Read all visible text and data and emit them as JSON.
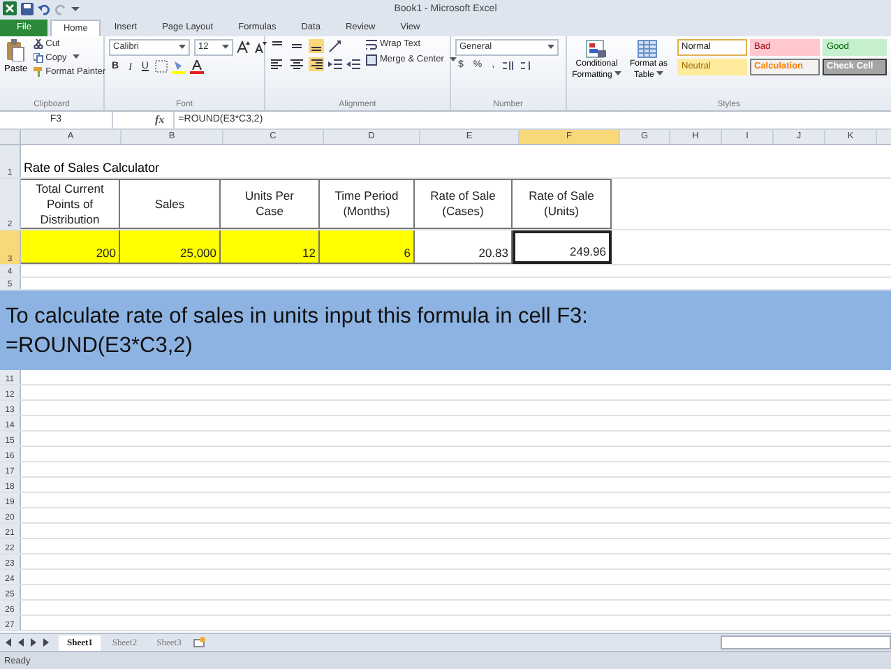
{
  "window": {
    "title": "Book1  -  Microsoft Excel"
  },
  "tabs": [
    {
      "label": "File",
      "selected": false,
      "kind": "file"
    },
    {
      "label": "Home",
      "selected": true,
      "kind": "tab"
    },
    {
      "label": "Insert",
      "selected": false,
      "kind": "tab"
    },
    {
      "label": "Page Layout",
      "selected": false,
      "kind": "tab"
    },
    {
      "label": "Formulas",
      "selected": false,
      "kind": "tab"
    },
    {
      "label": "Data",
      "selected": false,
      "kind": "tab"
    },
    {
      "label": "Review",
      "selected": false,
      "kind": "tab"
    },
    {
      "label": "View",
      "selected": false,
      "kind": "tab"
    }
  ],
  "ribbon": {
    "clipboard": {
      "paste": "Paste",
      "cut": "Cut",
      "copy": "Copy",
      "format_painter": "Format Painter",
      "label": "Clipboard"
    },
    "font": {
      "font_name": "Calibri",
      "font_size": "12",
      "styles": [
        "B",
        "I",
        "U"
      ],
      "label": "Font"
    },
    "alignment": {
      "wrap_text": "Wrap Text",
      "merge_center": "Merge & Center",
      "label": "Alignment"
    },
    "number": {
      "format": "General",
      "symbols": [
        "$",
        "%",
        ","
      ],
      "label": "Number"
    },
    "styles": {
      "conditional_formatting": [
        "Conditional",
        "Formatting"
      ],
      "format_as_table": [
        "Format as",
        "Table"
      ],
      "cells": [
        {
          "label": "Normal",
          "kind": "normal"
        },
        {
          "label": "Bad",
          "kind": "bad"
        },
        {
          "label": "Good",
          "kind": "good"
        },
        {
          "label": "Neutral",
          "kind": "neutral"
        },
        {
          "label": "Calculation",
          "kind": "calculation"
        },
        {
          "label": "Check Cell",
          "kind": "check"
        }
      ],
      "label": "Styles"
    }
  },
  "formula_bar": {
    "name_box": "F3",
    "fx": "fx",
    "formula": "=ROUND(E3*C3,2)"
  },
  "columns": [
    {
      "label": "A",
      "selected": false
    },
    {
      "label": "B",
      "selected": false
    },
    {
      "label": "C",
      "selected": false
    },
    {
      "label": "D",
      "selected": false
    },
    {
      "label": "E",
      "selected": false
    },
    {
      "label": "F",
      "selected": true
    },
    {
      "label": "G",
      "selected": false
    },
    {
      "label": "H",
      "selected": false
    },
    {
      "label": "I",
      "selected": false
    },
    {
      "label": "J",
      "selected": false
    },
    {
      "label": "K",
      "selected": false
    }
  ],
  "rows_top": [
    {
      "number": "1",
      "selected": false,
      "kind": "title",
      "title": "Rate of Sales Calculator"
    },
    {
      "number": "2",
      "selected": false,
      "kind": "header",
      "cells": [
        {
          "text": "Total Current Points of Distribution"
        },
        {
          "text": "Sales"
        },
        {
          "text": "Units Per Case"
        },
        {
          "text": "Time Period (Months)"
        },
        {
          "text": "Rate of Sale (Cases)"
        },
        {
          "text": "Rate of Sale (Units)"
        }
      ]
    },
    {
      "number": "3",
      "selected": true,
      "kind": "data",
      "cells": [
        {
          "text": "200",
          "highlight": true,
          "selected": false
        },
        {
          "text": "25,000",
          "highlight": true,
          "selected": false
        },
        {
          "text": "12",
          "highlight": true,
          "selected": false
        },
        {
          "text": "6",
          "highlight": true,
          "selected": false
        },
        {
          "text": "20.83",
          "highlight": false,
          "selected": false
        },
        {
          "text": "249.96",
          "highlight": false,
          "selected": true
        }
      ]
    },
    {
      "number": "4",
      "selected": false,
      "kind": "empty"
    },
    {
      "number": "5",
      "selected": false,
      "kind": "empty"
    }
  ],
  "banner": {
    "lines": [
      "To calculate rate of sales in units input this formula in cell F3:",
      "=ROUND(E3*C3,2)"
    ]
  },
  "rows_bottom": [
    {
      "number": "11"
    },
    {
      "number": "12"
    },
    {
      "number": "13"
    },
    {
      "number": "14"
    },
    {
      "number": "15"
    },
    {
      "number": "16"
    },
    {
      "number": "17"
    },
    {
      "number": "18"
    },
    {
      "number": "19"
    },
    {
      "number": "20"
    },
    {
      "number": "21"
    },
    {
      "number": "22"
    },
    {
      "number": "23"
    },
    {
      "number": "24"
    },
    {
      "number": "25"
    },
    {
      "number": "26"
    },
    {
      "number": "27"
    }
  ],
  "sheets": [
    {
      "label": "Sheet1",
      "selected": true
    },
    {
      "label": "Sheet2",
      "selected": false
    },
    {
      "label": "Sheet3",
      "selected": false
    }
  ],
  "status_bar": {
    "text": "Ready"
  }
}
